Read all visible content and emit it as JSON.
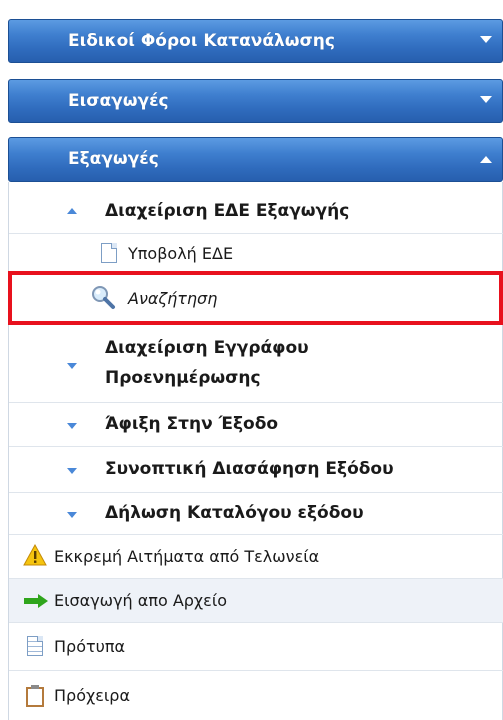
{
  "sections": [
    {
      "label": "Ειδικοί Φόροι Κατανάλωσης",
      "state": "collapsed"
    },
    {
      "label": "Εισαγωγές",
      "state": "collapsed"
    },
    {
      "label": "Εξαγωγές",
      "state": "expanded"
    }
  ],
  "exports_tree": {
    "group_label": "Διαχείριση ΕΔΕ Εξαγωγής",
    "submit_label": "Υποβολή ΕΔΕ",
    "search_label": "Αναζήτηση",
    "doc_mgmt_line1": "Διαχείριση Εγγράφου",
    "doc_mgmt_line2": "Προενημέρωσης",
    "arrival_label": "Άφιξη Στην Έξοδο",
    "summary_label": "Συνοπτική Διασάφηση Εξόδου",
    "list_label": "Δήλωση Καταλόγου εξόδου"
  },
  "bottom_items": {
    "pending_label": "Εκκρεμή Αιτήματα από Τελωνεία",
    "import_file_label": "Εισαγωγή απο Αρχείο",
    "templates_label": "Πρότυπα",
    "drafts_label": "Πρόχειρα"
  },
  "icons": {
    "warning": "warning-icon",
    "arrow": "green-arrow-icon",
    "search": "magnifier-icon",
    "document": "document-icon",
    "clipboard": "clipboard-icon"
  },
  "colors": {
    "header_blue": "#2f6bbd",
    "highlight_red": "#e8111d",
    "arrow_green": "#2fa51c",
    "triangle_blue": "#4a88d8"
  }
}
